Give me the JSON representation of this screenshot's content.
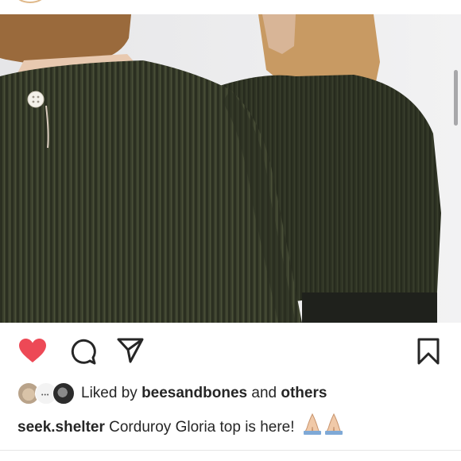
{
  "post": {
    "image_alt": "",
    "colors": {
      "like_red": "#ed4956",
      "text": "#262626",
      "corduroy": "#3a3f2c"
    }
  },
  "actions": {
    "like_icon": "heart-filled-icon",
    "comment_icon": "comment-bubble-icon",
    "share_icon": "paper-plane-icon",
    "save_icon": "bookmark-icon",
    "liked": true
  },
  "likes": {
    "prefix": "Liked by",
    "user": "beesandbones",
    "joiner": "and",
    "others": "others"
  },
  "caption": {
    "username": "seek.shelter",
    "text": "Corduroy Gloria top is here!",
    "emoji": "folded-hands-icon"
  }
}
